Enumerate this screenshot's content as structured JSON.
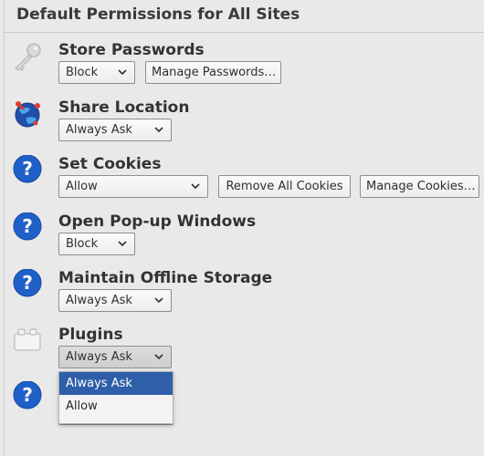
{
  "title": "Default Permissions for All Sites",
  "permissions": [
    {
      "title": "Store Passwords",
      "select": "Block",
      "buttons": [
        "Manage Passwords…"
      ],
      "icon": "key-icon"
    },
    {
      "title": "Share Location",
      "select": "Always Ask",
      "buttons": [],
      "icon": "globe-location-icon"
    },
    {
      "title": "Set Cookies",
      "select": "Allow",
      "buttons": [
        "Remove All Cookies",
        "Manage Cookies…"
      ],
      "icon": "question-icon"
    },
    {
      "title": "Open Pop-up Windows",
      "select": "Block",
      "buttons": [],
      "icon": "question-icon"
    },
    {
      "title": "Maintain Offline Storage",
      "select": "Always Ask",
      "buttons": [],
      "icon": "question-icon"
    },
    {
      "title": "Plugins",
      "select": "Always Ask",
      "buttons": [],
      "icon": "plugin-block-icon"
    }
  ],
  "dropdown": {
    "options": [
      "Always Ask",
      "Allow"
    ],
    "selected": "Always Ask"
  }
}
